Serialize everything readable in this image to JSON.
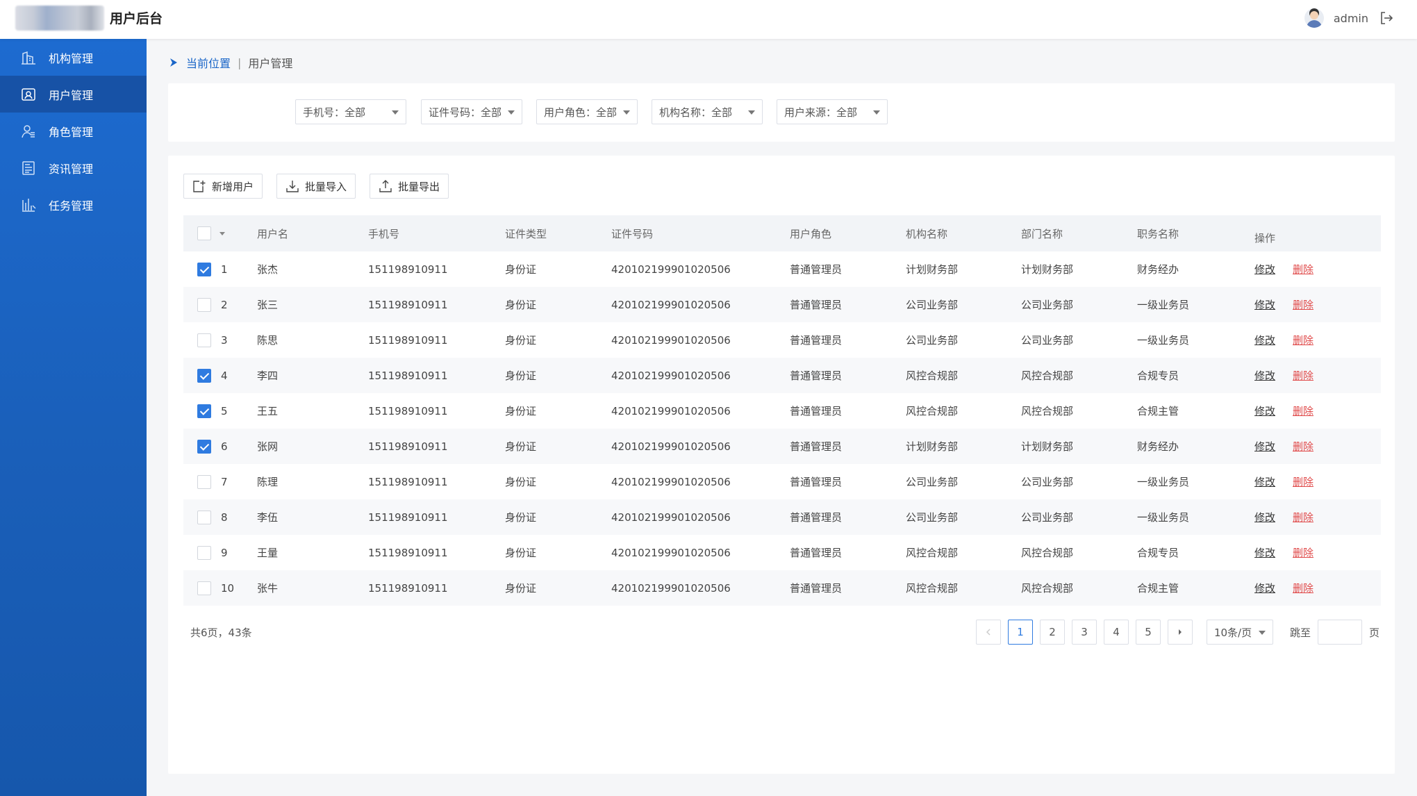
{
  "app": {
    "title": "用户后台",
    "user": "admin"
  },
  "sidebar": {
    "items": [
      {
        "label": "机构管理",
        "icon": "building-icon"
      },
      {
        "label": "用户管理",
        "icon": "user-card-icon",
        "active": true
      },
      {
        "label": "角色管理",
        "icon": "role-icon"
      },
      {
        "label": "资讯管理",
        "icon": "news-icon"
      },
      {
        "label": "任务管理",
        "icon": "task-chart-icon"
      }
    ]
  },
  "breadcrumb": {
    "current": "当前位置",
    "separator": "|",
    "page": "用户管理"
  },
  "filters": [
    {
      "label": "手机号：全部"
    },
    {
      "label": "证件号码：全部"
    },
    {
      "label": "用户角色：全部"
    },
    {
      "label": "机构名称：全部"
    },
    {
      "label": "用户来源：全部"
    }
  ],
  "toolbar": {
    "add": "新增用户",
    "import": "批量导入",
    "export": "批量导出"
  },
  "table": {
    "columns": [
      "用户名",
      "手机号",
      "证件类型",
      "证件号码",
      "用户角色",
      "机构名称",
      "部门名称",
      "职务名称",
      "操作"
    ],
    "edit_label": "修改",
    "delete_label": "删除",
    "rows": [
      {
        "no": "1",
        "checked": true,
        "name": "张杰",
        "phone": "151198910911",
        "idtype": "身份证",
        "idno": "420102199901020506",
        "role": "普通管理员",
        "org": "计划财务部",
        "dept": "计划财务部",
        "title": "财务经办"
      },
      {
        "no": "2",
        "checked": false,
        "name": "张三",
        "phone": "151198910911",
        "idtype": "身份证",
        "idno": "420102199901020506",
        "role": "普通管理员",
        "org": "公司业务部",
        "dept": "公司业务部",
        "title": "一级业务员"
      },
      {
        "no": "3",
        "checked": false,
        "name": "陈思",
        "phone": "151198910911",
        "idtype": "身份证",
        "idno": "420102199901020506",
        "role": "普通管理员",
        "org": "公司业务部",
        "dept": "公司业务部",
        "title": "一级业务员"
      },
      {
        "no": "4",
        "checked": true,
        "name": "李四",
        "phone": "151198910911",
        "idtype": "身份证",
        "idno": "420102199901020506",
        "role": "普通管理员",
        "org": "风控合规部",
        "dept": "风控合规部",
        "title": "合规专员"
      },
      {
        "no": "5",
        "checked": true,
        "name": "王五",
        "phone": "151198910911",
        "idtype": "身份证",
        "idno": "420102199901020506",
        "role": "普通管理员",
        "org": "风控合规部",
        "dept": "风控合规部",
        "title": "合规主管"
      },
      {
        "no": "6",
        "checked": true,
        "name": "张网",
        "phone": "151198910911",
        "idtype": "身份证",
        "idno": "420102199901020506",
        "role": "普通管理员",
        "org": "计划财务部",
        "dept": "计划财务部",
        "title": "财务经办"
      },
      {
        "no": "7",
        "checked": false,
        "name": "陈理",
        "phone": "151198910911",
        "idtype": "身份证",
        "idno": "420102199901020506",
        "role": "普通管理员",
        "org": "公司业务部",
        "dept": "公司业务部",
        "title": "一级业务员"
      },
      {
        "no": "8",
        "checked": false,
        "name": "李伍",
        "phone": "151198910911",
        "idtype": "身份证",
        "idno": "420102199901020506",
        "role": "普通管理员",
        "org": "公司业务部",
        "dept": "公司业务部",
        "title": "一级业务员"
      },
      {
        "no": "9",
        "checked": false,
        "name": "王量",
        "phone": "151198910911",
        "idtype": "身份证",
        "idno": "420102199901020506",
        "role": "普通管理员",
        "org": "风控合规部",
        "dept": "风控合规部",
        "title": "合规专员"
      },
      {
        "no": "10",
        "checked": false,
        "name": "张牛",
        "phone": "151198910911",
        "idtype": "身份证",
        "idno": "420102199901020506",
        "role": "普通管理员",
        "org": "风控合规部",
        "dept": "风控合规部",
        "title": "合规主管"
      }
    ]
  },
  "pagination": {
    "summary": "共6页，43条",
    "pages": [
      "1",
      "2",
      "3",
      "4",
      "5"
    ],
    "current": "1",
    "page_size": "10条/页",
    "jump_label": "跳至",
    "page_unit": "页"
  },
  "colors": {
    "sidebar": "#1a5fb9",
    "accent": "#2f7be0",
    "danger": "#e04b4b"
  }
}
